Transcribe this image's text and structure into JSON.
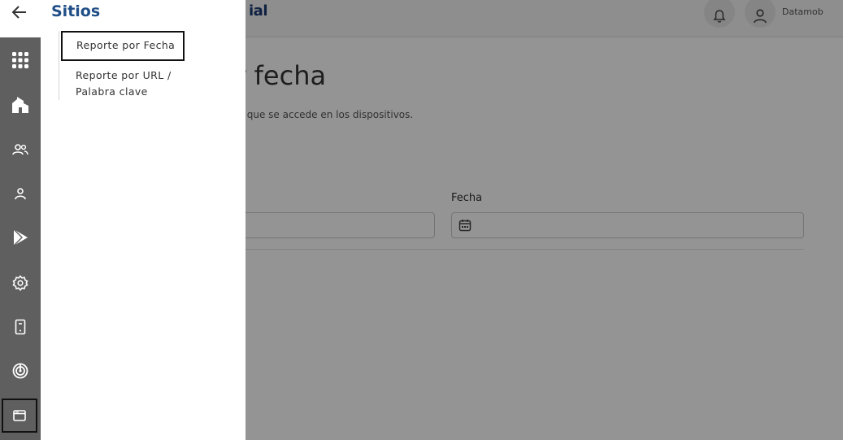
{
  "header": {
    "brand_partial": "ial",
    "user_name": "Datamob"
  },
  "main": {
    "title_partial": "os por fecha",
    "description_partial": "ea de tiempo de los sitios a los que se accede en los dispositivos.",
    "date_field_label": "Fecha"
  },
  "rail": {
    "items": [
      {
        "icon": "apps-grid-icon"
      },
      {
        "icon": "building-icon"
      },
      {
        "icon": "users-icon"
      },
      {
        "icon": "user-icon"
      },
      {
        "icon": "play-store-icon"
      },
      {
        "icon": "settings-icon"
      },
      {
        "icon": "device-icon"
      },
      {
        "icon": "radar-icon"
      },
      {
        "icon": "browser-window-icon"
      }
    ]
  },
  "panel": {
    "title": "Sitios",
    "items": [
      {
        "label": "Reporte por Fecha",
        "active": true
      },
      {
        "label": "Reporte por URL / Palabra clave",
        "active": false
      }
    ]
  },
  "colors": {
    "rail_bg": "#5f5f5f",
    "panel_title": "#1f4e86",
    "brand": "#1a3a73"
  }
}
